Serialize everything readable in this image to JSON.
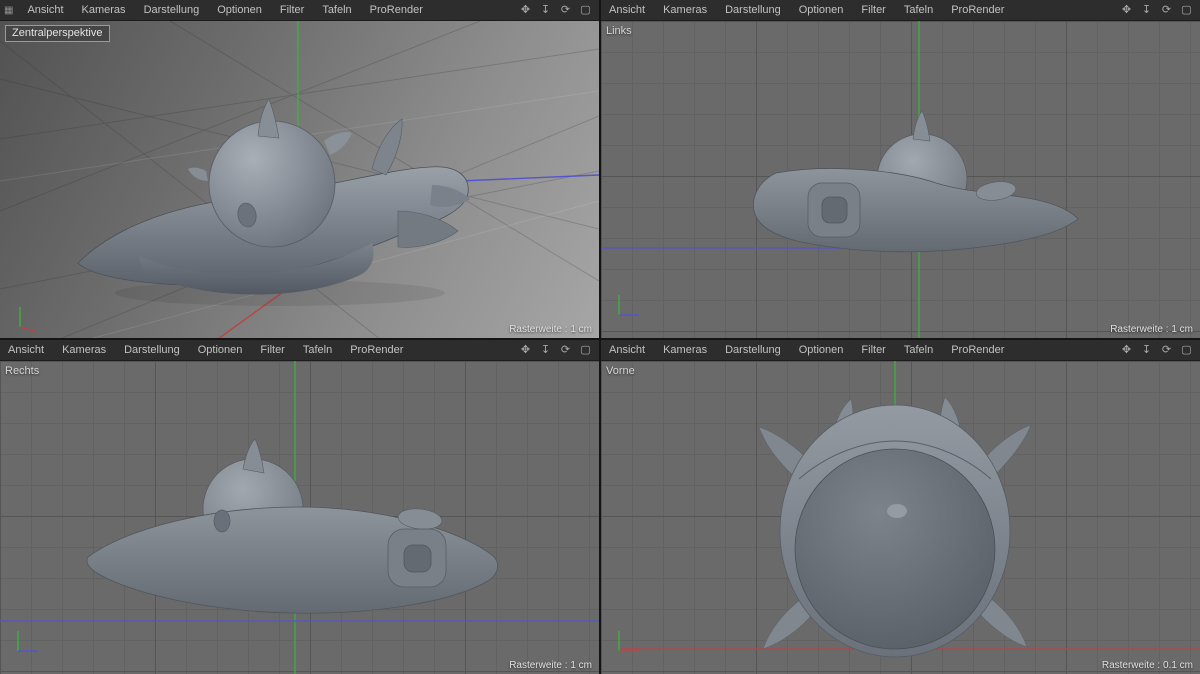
{
  "menu": {
    "handle_glyph": "▦",
    "items": [
      "Ansicht",
      "Kameras",
      "Darstellung",
      "Optionen",
      "Filter",
      "Tafeln",
      "ProRender"
    ]
  },
  "view_icons": [
    {
      "name": "pan-view-icon",
      "glyph": "✥"
    },
    {
      "name": "dolly-view-icon",
      "glyph": "↧"
    },
    {
      "name": "rotate-view-icon",
      "glyph": "⟳"
    },
    {
      "name": "toggle-view-icon",
      "glyph": "▢"
    }
  ],
  "viewports": [
    {
      "id": "perspective",
      "label": "Zentralperspektive",
      "grid_label": "Rasterweite : 1 cm"
    },
    {
      "id": "left",
      "label": "Links",
      "grid_label": "Rasterweite : 1 cm"
    },
    {
      "id": "right",
      "label": "Rechts",
      "grid_label": "Rasterweite : 1 cm"
    },
    {
      "id": "front",
      "label": "Vorne",
      "grid_label": "Rasterweite : 0.1 cm"
    }
  ],
  "colors": {
    "axis_x": "#bb4444",
    "axis_y": "#3fae3f",
    "axis_z": "#5555cc",
    "model_light": "#99a0a8",
    "model_dark": "#5d636c",
    "menubar_bg": "#2d2d2d"
  }
}
